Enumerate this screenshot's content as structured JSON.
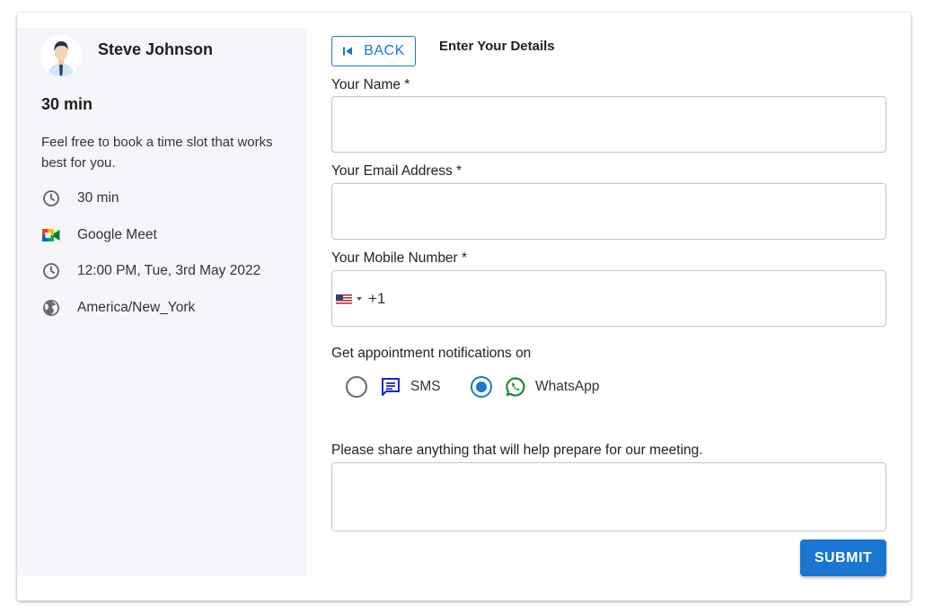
{
  "host": {
    "name": "Steve Johnson"
  },
  "event": {
    "title": "30 min",
    "description": "Feel free to book a time slot that works best for you.",
    "details": {
      "duration": "30 min",
      "location": "Google Meet",
      "datetime": "12:00 PM, Tue, 3rd May 2022",
      "timezone": "America/New_York"
    }
  },
  "form": {
    "back_label": "BACK",
    "title": "Enter Your Details",
    "name_label": "Your Name *",
    "name_value": "",
    "email_label": "Your Email Address *",
    "email_value": "",
    "mobile_label": "Your Mobile Number *",
    "country_code": "+1",
    "country_flag": "us-flag-icon",
    "mobile_value": "",
    "notify_label": "Get appointment notifications on",
    "notify_options": [
      {
        "label": "SMS",
        "icon": "sms-icon",
        "selected": false
      },
      {
        "label": "WhatsApp",
        "icon": "whatsapp-icon",
        "selected": true
      }
    ],
    "share_label": "Please share anything that will help prepare for our meeting.",
    "share_value": "",
    "submit_label": "SUBMIT"
  },
  "colors": {
    "accent": "#1976d2",
    "panel_bg": "#f5f6fa",
    "sms_icon": "#1a24c8",
    "whatsapp_icon": "#1a8a2a"
  }
}
